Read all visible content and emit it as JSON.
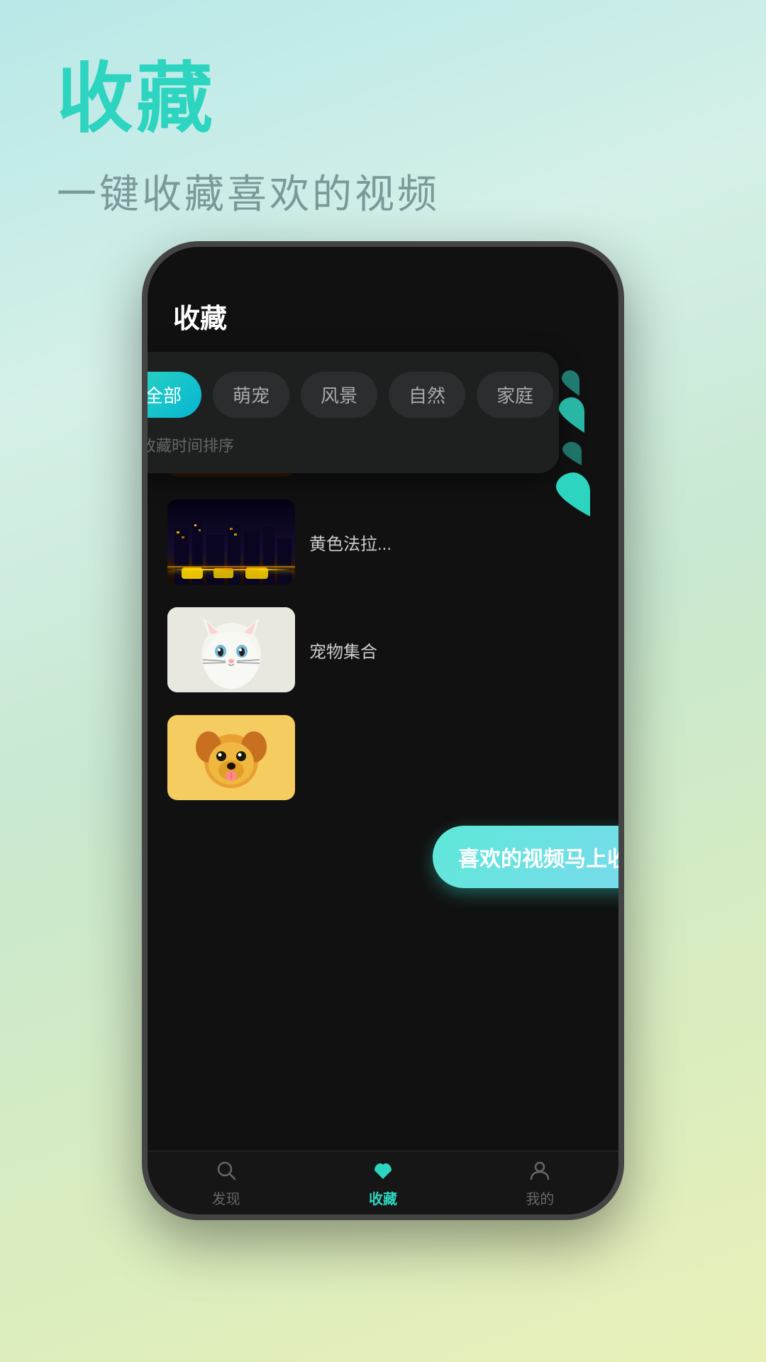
{
  "page": {
    "background": "linear-gradient(160deg, #b8e8e8, #d4f0e8, #c8e8d0, #d8ecc0, #e8f0b8)"
  },
  "hero": {
    "title": "收藏",
    "subtitle": "一键收藏喜欢的视频"
  },
  "phone": {
    "screen_title": "收藏",
    "filter_tabs": [
      {
        "label": "全部",
        "active": true
      },
      {
        "label": "萌宠",
        "active": false
      },
      {
        "label": "风景",
        "active": false
      },
      {
        "label": "自然",
        "active": false
      },
      {
        "label": "家庭",
        "active": false
      }
    ],
    "sort_label": "按收藏时间排序",
    "video_list": [
      {
        "title": "",
        "thumb_type": "eiffel"
      },
      {
        "title": "黄色法拉...",
        "thumb_type": "city"
      },
      {
        "title": "宠物集合",
        "thumb_type": "cat"
      },
      {
        "title": "",
        "thumb_type": "dog"
      }
    ],
    "bottom_nav": [
      {
        "label": "发现",
        "active": false,
        "icon": "🔍"
      },
      {
        "label": "收藏",
        "active": true,
        "icon": "⭐"
      },
      {
        "label": "我的",
        "active": false,
        "icon": "👤"
      }
    ]
  },
  "tooltip": {
    "text": "喜欢的视频马上收藏"
  },
  "hearts": [
    {
      "size": 24,
      "color": "#2dd4bf",
      "opacity": 0.6
    },
    {
      "size": 36,
      "color": "#2dd4bf",
      "opacity": 0.85
    },
    {
      "size": 28,
      "color": "#2dd4bf",
      "opacity": 0.5
    },
    {
      "size": 44,
      "color": "#2dd4bf",
      "opacity": 1.0
    }
  ]
}
